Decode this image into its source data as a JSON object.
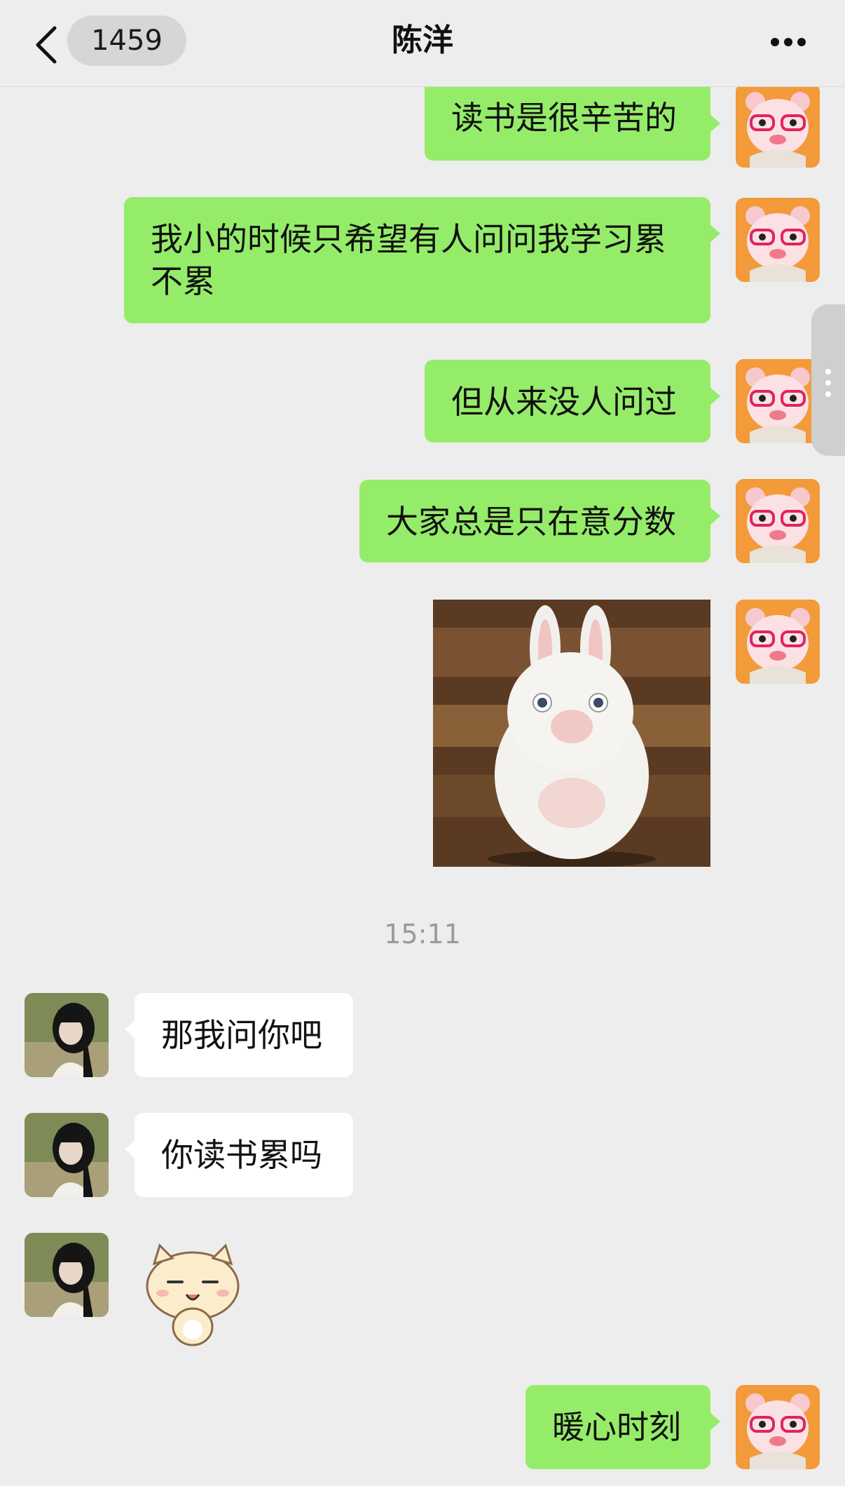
{
  "header": {
    "back_count": "1459",
    "title": "陈洋",
    "more_icon": "more-dots-icon",
    "back_icon": "chevron-left-icon"
  },
  "messages": [
    {
      "side": "me",
      "type": "text",
      "text": "读书是很辛苦的"
    },
    {
      "side": "me",
      "type": "text",
      "text": "我小的时候只希望有人问问我学习累不累"
    },
    {
      "side": "me",
      "type": "text",
      "text": "但从来没人问过"
    },
    {
      "side": "me",
      "type": "text",
      "text": "大家总是只在意分数"
    },
    {
      "side": "me",
      "type": "image",
      "image": "white-rabbit-photo"
    },
    {
      "type": "time",
      "text": "15:11"
    },
    {
      "side": "other",
      "type": "text",
      "text": "那我问你吧"
    },
    {
      "side": "other",
      "type": "text",
      "text": "你读书累吗"
    },
    {
      "side": "other",
      "type": "sticker",
      "image": "cat-sticker"
    },
    {
      "side": "me",
      "type": "text",
      "text": "暖心时刻"
    }
  ],
  "colors": {
    "me_bubble": "#95ec69",
    "other_bubble": "#ffffff",
    "background": "#ededed"
  }
}
